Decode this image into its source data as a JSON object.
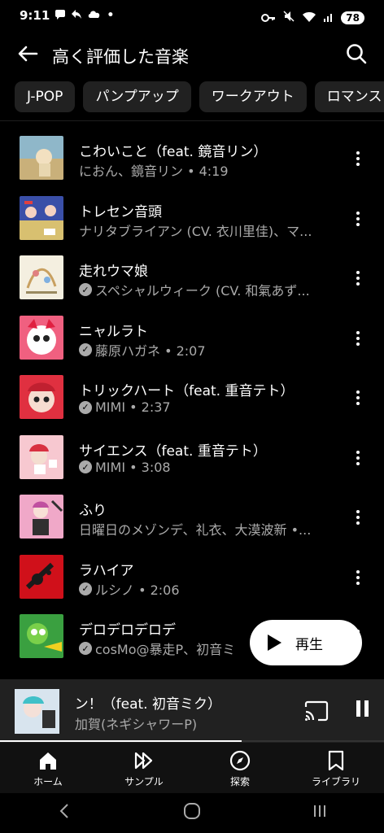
{
  "status_bar": {
    "time": "9:11",
    "battery": "78"
  },
  "header": {
    "title": "高く評価した音楽"
  },
  "chips": [
    "J-POP",
    "パンプアップ",
    "ワークアウト",
    "ロマンス"
  ],
  "songs": [
    {
      "title": "こわいこと（feat. 鏡音リン）",
      "subtitle": "におん、鏡音リン • 4:19",
      "verified": false
    },
    {
      "title": "トレセン音頭",
      "subtitle": "ナリタブライアン (CV. 衣川里佳)、マ...",
      "verified": false
    },
    {
      "title": "走れウマ娘",
      "subtitle": "スペシャルウィーク (CV. 和氣あず...",
      "verified": true
    },
    {
      "title": "ニャルラト",
      "subtitle": "藤原ハガネ • 2:07",
      "verified": true
    },
    {
      "title": "トリックハート（feat. 重音テト）",
      "subtitle": "MIMI • 2:37",
      "verified": true
    },
    {
      "title": "サイエンス（feat. 重音テト）",
      "subtitle": "MIMI • 3:08",
      "verified": true
    },
    {
      "title": "ふり",
      "subtitle": "日曜日のメゾンデ、礼衣、大漠波新 •...",
      "verified": false
    },
    {
      "title": "ラハイア",
      "subtitle": "ルシノ • 2:06",
      "verified": true
    },
    {
      "title": "デロデロデロデ",
      "subtitle": "cosMo@暴走P、初音ミ",
      "verified": true
    }
  ],
  "play_button": {
    "label": "再生"
  },
  "now_playing": {
    "title": "ョン！（feat. 初音ミク）",
    "artist": "加賀(ネギシャワーP)",
    "progress": 0.63
  },
  "bottom_nav": [
    "ホーム",
    "サンプル",
    "探索",
    "ライブラリ"
  ],
  "colors": {
    "background": "#000000",
    "chip": "#212121",
    "mini_player": "#212121",
    "subtext": "#aaaaaa"
  }
}
